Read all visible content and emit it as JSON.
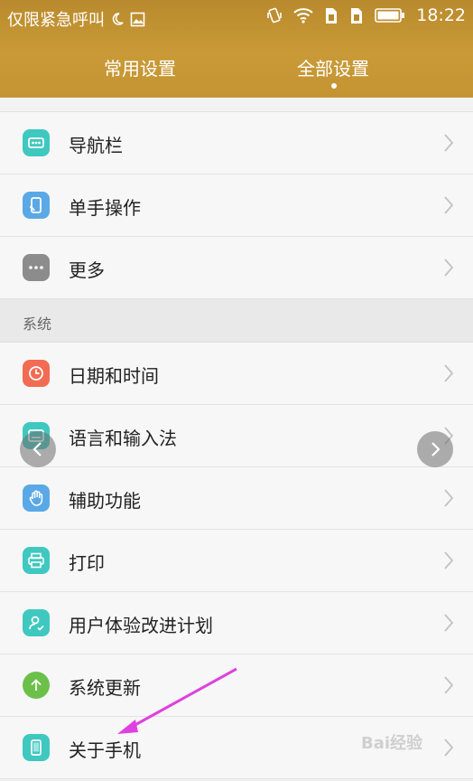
{
  "status_bar": {
    "carrier": "仅限紧急呼叫",
    "time": "18:22",
    "icons": [
      "moon-icon",
      "image-icon",
      "vibrate-icon",
      "wifi-icon",
      "sim1-icon",
      "sim2-icon",
      "battery-icon"
    ]
  },
  "tabs": [
    {
      "label": "常用设置",
      "selected": false
    },
    {
      "label": "全部设置",
      "selected": true
    }
  ],
  "group1": {
    "items": [
      {
        "label": "导航栏",
        "icon": "navbar-icon",
        "color": "#3fc8c0"
      },
      {
        "label": "单手操作",
        "icon": "one-hand-icon",
        "color": "#5aa9e6"
      },
      {
        "label": "更多",
        "icon": "more-icon",
        "color": "#8c8c8c"
      }
    ]
  },
  "section_system": {
    "title": "系统",
    "items": [
      {
        "label": "日期和时间",
        "icon": "clock-icon",
        "color": "#f26b53"
      },
      {
        "label": "语言和输入法",
        "icon": "language-icon",
        "color": "#3fc8c0"
      },
      {
        "label": "辅助功能",
        "icon": "hand-icon",
        "color": "#5aa9e6"
      },
      {
        "label": "打印",
        "icon": "printer-icon",
        "color": "#3fc8c0"
      },
      {
        "label": "用户体验改进计划",
        "icon": "user-experience-icon",
        "color": "#3fc8c0"
      },
      {
        "label": "系统更新",
        "icon": "update-icon",
        "color": "#6cc04a"
      },
      {
        "label": "关于手机",
        "icon": "phone-icon",
        "color": "#3fc8c0"
      }
    ]
  },
  "watermark": "Bai经验"
}
